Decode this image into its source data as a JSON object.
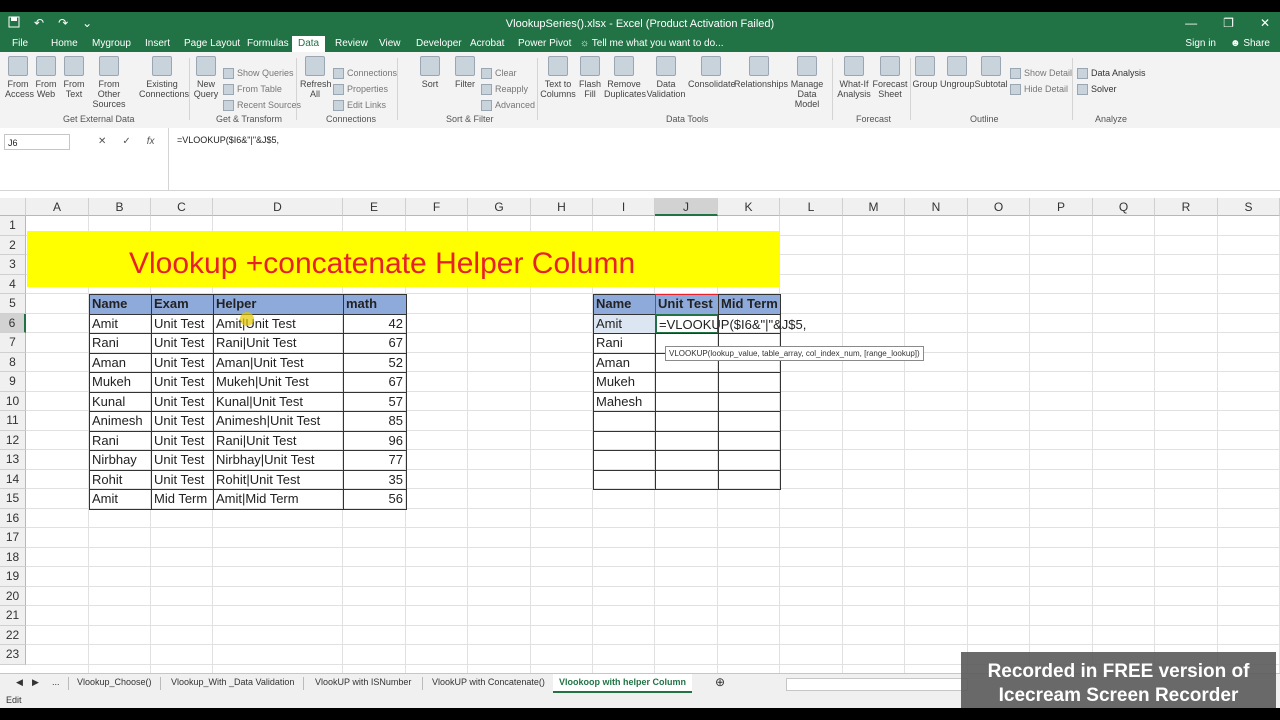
{
  "window": {
    "title": "VlookupSeries().xlsx - Excel (Product Activation Failed)",
    "min_glyph": "—",
    "max_glyph": "❐",
    "close_glyph": "✕"
  },
  "qat": {
    "save_icon": "save-icon",
    "undo_glyph": "↶",
    "redo_glyph": "↷",
    "customize_glyph": "⌄"
  },
  "menu": {
    "tabs": [
      "File",
      "Home",
      "Mygroup",
      "Insert",
      "Page Layout",
      "Formulas",
      "Data",
      "Review",
      "View",
      "Developer",
      "Acrobat",
      "Power Pivot"
    ],
    "active": "Data",
    "tell_me": "Tell me what you want to do...",
    "signin": "Sign in",
    "share": "Share"
  },
  "ribbon": {
    "buttons": [
      {
        "label": "From Access"
      },
      {
        "label": "From Web"
      },
      {
        "label": "From Text"
      },
      {
        "label": "From Other Sources"
      },
      {
        "label": "Existing Connections"
      },
      {
        "label": "New Query"
      },
      {
        "label": "Refresh All"
      },
      {
        "label": "Sort"
      },
      {
        "label": "Filter"
      },
      {
        "label": "Text to Columns"
      },
      {
        "label": "Flash Fill"
      },
      {
        "label": "Remove Duplicates"
      },
      {
        "label": "Data Validation"
      },
      {
        "label": "Consolidate"
      },
      {
        "label": "Relationships"
      },
      {
        "label": "Manage Data Model"
      },
      {
        "label": "What-If Analysis"
      },
      {
        "label": "Forecast Sheet"
      },
      {
        "label": "Group"
      },
      {
        "label": "Ungroup"
      },
      {
        "label": "Subtotal"
      }
    ],
    "small": {
      "show_queries": "Show Queries",
      "from_table": "From Table",
      "recent_sources": "Recent Sources",
      "connections": "Connections",
      "properties": "Properties",
      "edit_links": "Edit Links",
      "clear": "Clear",
      "reapply": "Reapply",
      "advanced": "Advanced",
      "show_detail": "Show Detail",
      "hide_detail": "Hide Detail",
      "data_analysis": "Data Analysis",
      "solver": "Solver"
    },
    "groups": {
      "get_external": "Get External Data",
      "get_transform": "Get & Transform",
      "connections": "Connections",
      "sort_filter": "Sort & Filter",
      "data_tools": "Data Tools",
      "forecast": "Forecast",
      "outline": "Outline",
      "analyze": "Analyze"
    }
  },
  "formula_bar": {
    "name_box": "J6",
    "cancel_glyph": "✕",
    "enter_glyph": "✓",
    "fx": "fx",
    "formula": "=VLOOKUP($I6&\"|\"&J$5,"
  },
  "grid": {
    "columns": [
      "A",
      "B",
      "C",
      "D",
      "E",
      "F",
      "G",
      "H",
      "I",
      "J",
      "K",
      "L",
      "M",
      "N",
      "O",
      "P",
      "Q",
      "R",
      "S"
    ],
    "rows": [
      "1",
      "2",
      "3",
      "4",
      "5",
      "6",
      "7",
      "8",
      "9",
      "10",
      "11",
      "12",
      "13",
      "14",
      "15",
      "16",
      "17",
      "18",
      "19",
      "20",
      "21",
      "22",
      "23"
    ],
    "selected_col": "J",
    "selected_row": "6"
  },
  "banner": {
    "text": "Vlookup +concatenate Helper Column",
    "bg": "#ffff00",
    "color": "#e8202a"
  },
  "table1": {
    "headers": [
      "Name",
      "Exam",
      "Helper",
      "math"
    ],
    "rows": [
      [
        "Amit",
        "Unit Test",
        "Amit|Unit Test",
        "42"
      ],
      [
        "Rani",
        "Unit Test",
        "Rani|Unit Test",
        "67"
      ],
      [
        "Aman",
        "Unit Test",
        "Aman|Unit Test",
        "52"
      ],
      [
        "Mukeh",
        "Unit Test",
        "Mukeh|Unit Test",
        "67"
      ],
      [
        "Kunal",
        "Unit Test",
        "Kunal|Unit Test",
        "57"
      ],
      [
        "Animesh",
        "Unit Test",
        "Animesh|Unit Test",
        "85"
      ],
      [
        "Rani",
        "Unit Test",
        "Rani|Unit Test",
        "96"
      ],
      [
        "Nirbhay",
        "Unit Test",
        "Nirbhay|Unit Test",
        "77"
      ],
      [
        "Rohit",
        "Unit Test",
        "Rohit|Unit Test",
        "35"
      ],
      [
        "Amit",
        "Mid Term",
        "Amit|Mid Term",
        "56"
      ]
    ],
    "header_bg": "#8eaadb"
  },
  "table2": {
    "headers": [
      "Name",
      "Unit Test",
      "Mid Term"
    ],
    "names": [
      "Amit",
      "Rani",
      "Aman",
      "Mukeh",
      "Mahesh",
      "",
      "",
      "",
      ""
    ],
    "editing_cell": "=VLOOKUP($I6&\"|\"&J$5,",
    "tooltip": "VLOOKUP(lookup_value, table_array, col_index_num, [range_lookup])"
  },
  "sheet_tabs": {
    "ellipsis": "...",
    "tabs": [
      "Vlookup_Choose()",
      "Vlookup_With _Data Validation",
      "VlookUP with ISNumber",
      "VlookUP with Concatenate()",
      "Vlookoop with helper Column"
    ],
    "active": "Vlookoop with helper Column",
    "add_glyph": "⊕"
  },
  "status": {
    "mode": "Edit"
  },
  "watermark": {
    "line1": "Recorded in FREE version of",
    "line2": "Icecream Screen Recorder"
  },
  "colors": {
    "excel_green": "#217346",
    "ribbon_bg": "#f3f3f3"
  }
}
